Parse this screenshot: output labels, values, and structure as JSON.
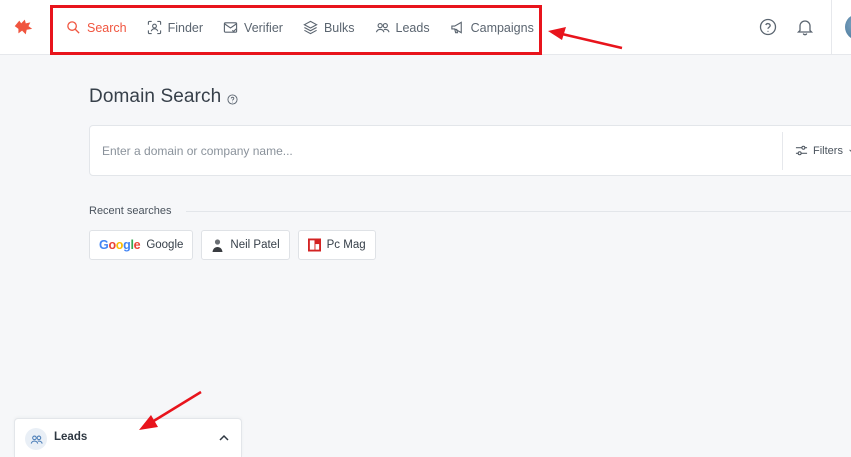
{
  "nav": {
    "items": [
      {
        "label": "Search",
        "icon": "search-icon",
        "active": true
      },
      {
        "label": "Finder",
        "icon": "user-scan-icon",
        "active": false
      },
      {
        "label": "Verifier",
        "icon": "mail-check-icon",
        "active": false
      },
      {
        "label": "Bulks",
        "icon": "layers-icon",
        "active": false
      },
      {
        "label": "Leads",
        "icon": "users-icon",
        "active": false
      },
      {
        "label": "Campaigns",
        "icon": "megaphone-icon",
        "active": false
      }
    ],
    "accent_color": "#f0553f"
  },
  "header": {
    "help_icon": "help-circle-icon",
    "notifications_icon": "bell-icon"
  },
  "main": {
    "title": "Domain Search",
    "search": {
      "placeholder": "Enter a domain or company name...",
      "value": "",
      "filters_label": "Filters"
    },
    "recent": {
      "label": "Recent searches",
      "items": [
        {
          "label": "Google",
          "logo_text": "Google"
        },
        {
          "label": "Neil Patel",
          "icon": "person-silhouette-icon"
        },
        {
          "label": "Pc Mag",
          "icon": "pcmag-logo-icon"
        }
      ]
    }
  },
  "leads_panel": {
    "label": "Leads",
    "icon": "users-icon",
    "expand_icon": "chevron-up-icon"
  },
  "annotation": {
    "color": "#e8141c"
  }
}
